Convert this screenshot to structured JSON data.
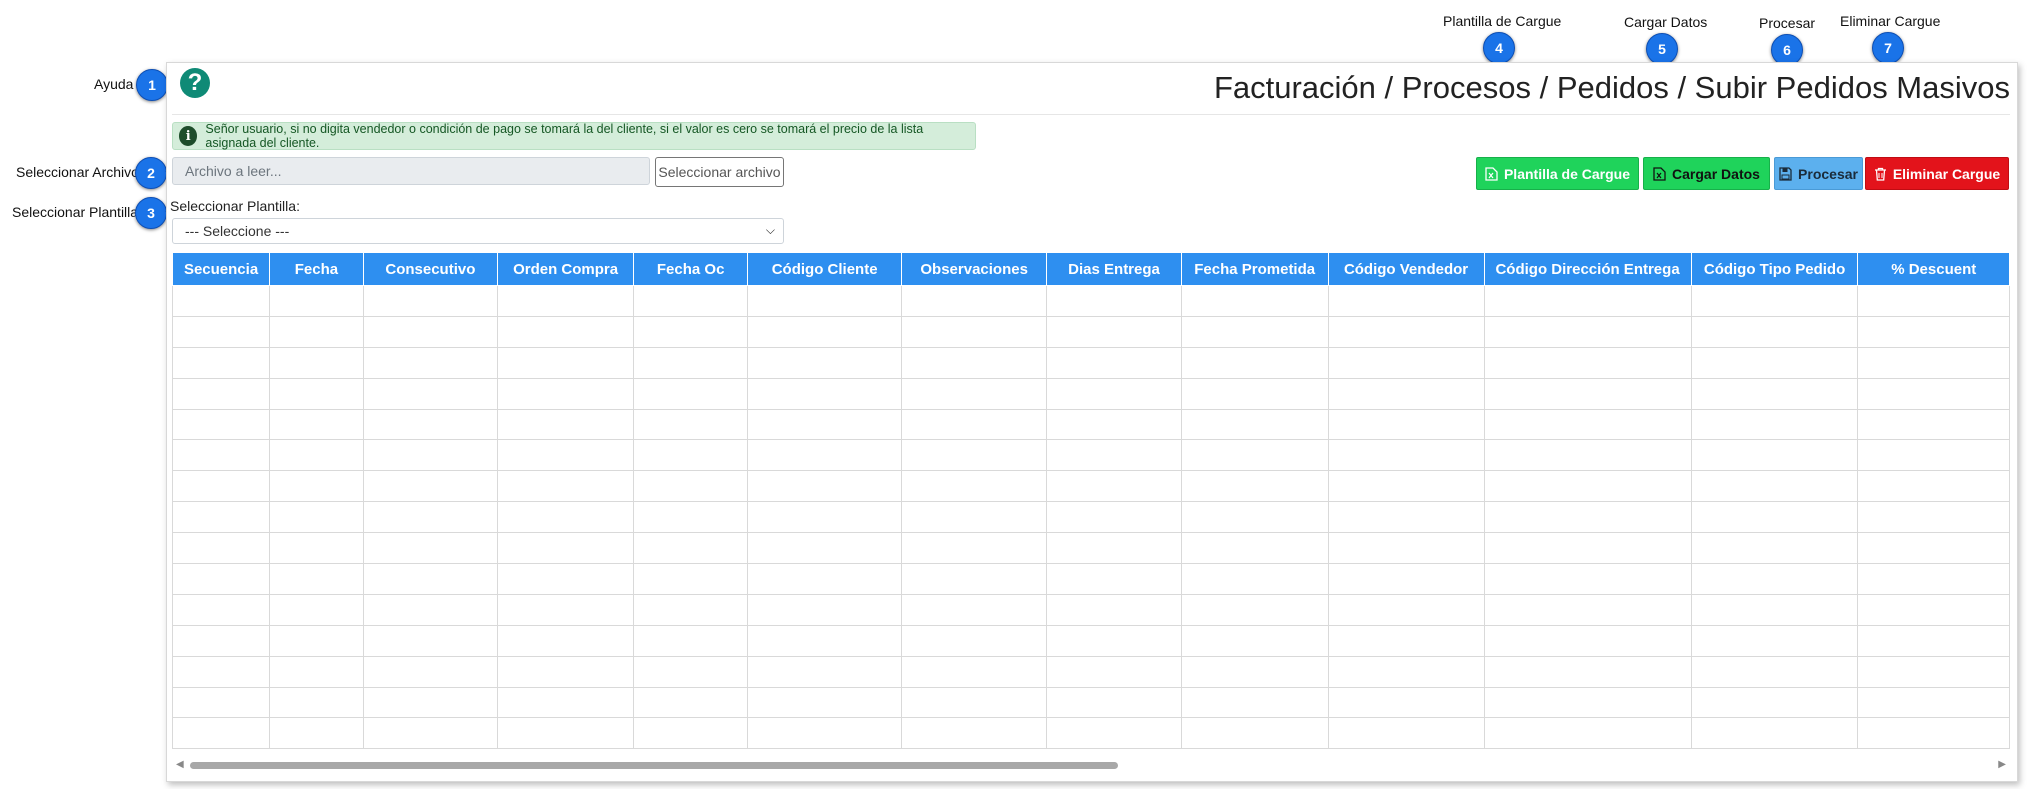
{
  "callouts": {
    "ayuda": {
      "number": "1",
      "label": "Ayuda"
    },
    "archivo": {
      "number": "2",
      "label": "Seleccionar Archivo"
    },
    "plantilla": {
      "number": "3",
      "label": "Seleccionar Plantilla"
    },
    "plantilla_cargue": {
      "number": "4",
      "label": "Plantilla de Cargue"
    },
    "cargar_datos": {
      "number": "5",
      "label": "Cargar Datos"
    },
    "procesar": {
      "number": "6",
      "label": "Procesar"
    },
    "eliminar": {
      "number": "7",
      "label": "Eliminar Cargue"
    }
  },
  "header": {
    "help_icon": "?",
    "title": "Facturación / Procesos / Pedidos / Subir Pedidos Masivos"
  },
  "alert": {
    "icon": "i",
    "text": "Señor usuario, si no digita vendedor o condición de pago se tomará la del cliente, si el valor es cero se tomará el precio de la lista asignada del cliente."
  },
  "file": {
    "placeholder": "Archivo a leer...",
    "button_label": "Seleccionar archivo"
  },
  "template": {
    "label": "Seleccionar Plantilla:",
    "selected": "--- Seleccione ---"
  },
  "toolbar": {
    "plantilla_cargue": "Plantilla de Cargue",
    "cargar_datos": "Cargar Datos",
    "procesar": "Procesar",
    "eliminar_cargue": "Eliminar Cargue"
  },
  "colors": {
    "primary_blue": "#2e8ff0",
    "green": "#1fd35b",
    "light_blue": "#5cb0ee",
    "red": "#e3131b",
    "callout_blue": "#1a73e8"
  },
  "table": {
    "columns": [
      "Secuencia",
      "Fecha",
      "Consecutivo",
      "Orden Compra",
      "Fecha Oc",
      "Código Cliente",
      "Observaciones",
      "Dias Entrega",
      "Fecha Prometida",
      "Código Vendedor",
      "Código Dirección Entrega",
      "Código Tipo Pedido",
      "% Descuent"
    ]
  }
}
